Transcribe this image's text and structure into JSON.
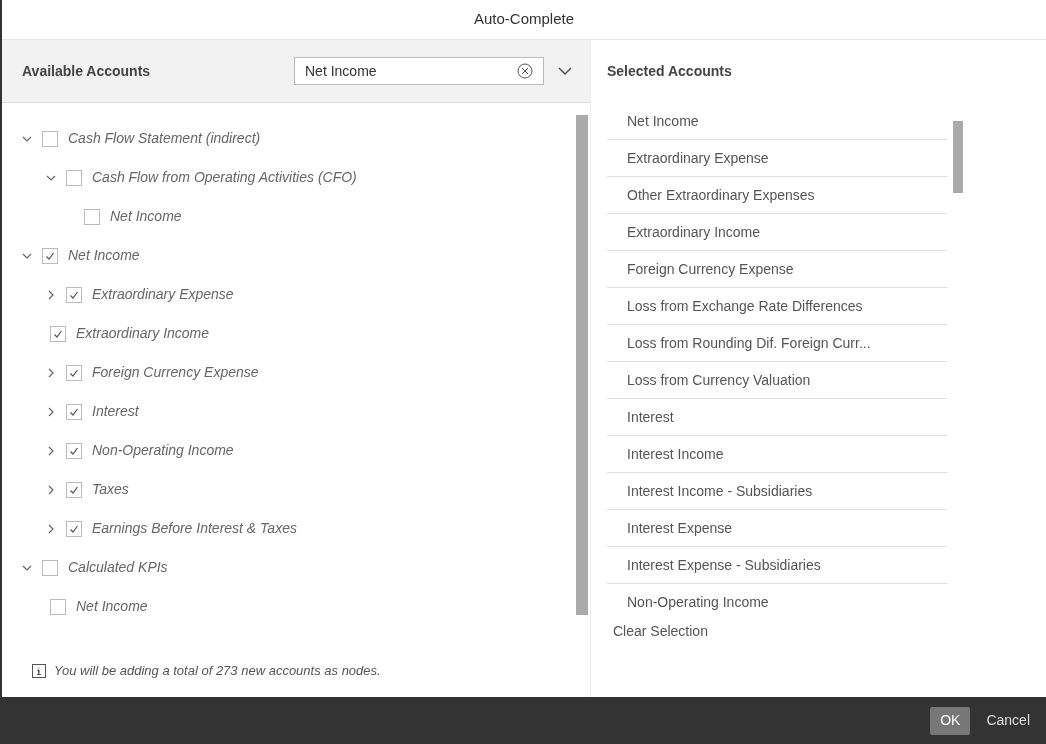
{
  "dialog": {
    "title": "Auto-Complete"
  },
  "available": {
    "title": "Available Accounts",
    "search": {
      "value": "Net Income"
    },
    "tree": [
      {
        "kind": "branch",
        "label": "Cash Flow Statement (indirect)",
        "checked": false,
        "expanded": true,
        "children": [
          {
            "kind": "branch",
            "label": "Cash Flow from Operating Activities (CFO)",
            "checked": false,
            "expanded": true,
            "children": [
              {
                "kind": "leaf",
                "label": "Net Income",
                "checked": false
              }
            ]
          }
        ]
      },
      {
        "kind": "branch",
        "label": "Net Income",
        "checked": true,
        "expanded": true,
        "children": [
          {
            "kind": "branch",
            "label": "Extraordinary Expense",
            "checked": true,
            "expanded": false
          },
          {
            "kind": "leaf",
            "label": "Extraordinary Income",
            "checked": true
          },
          {
            "kind": "branch",
            "label": "Foreign Currency Expense",
            "checked": true,
            "expanded": false
          },
          {
            "kind": "branch",
            "label": "Interest",
            "checked": true,
            "expanded": false
          },
          {
            "kind": "branch",
            "label": "Non-Operating Income",
            "checked": true,
            "expanded": false
          },
          {
            "kind": "branch",
            "label": "Taxes",
            "checked": true,
            "expanded": false
          },
          {
            "kind": "branch",
            "label": "Earnings Before Interest & Taxes",
            "checked": true,
            "expanded": false
          }
        ]
      },
      {
        "kind": "branch",
        "label": "Calculated KPIs",
        "checked": false,
        "expanded": true,
        "children": [
          {
            "kind": "leaf",
            "label": "Net Income",
            "checked": false
          }
        ]
      }
    ],
    "info": "You will be adding a total of 273 new accounts as nodes."
  },
  "selected": {
    "title": "Selected Accounts",
    "items": [
      "Net Income",
      "Extraordinary Expense",
      "Other Extraordinary Expenses",
      "Extraordinary Income",
      "Foreign Currency Expense",
      "Loss from Exchange Rate Differences",
      "Loss from Rounding Dif. Foreign Curr...",
      "Loss from Currency Valuation",
      "Interest",
      "Interest Income",
      "Interest Income - Subsidiaries",
      "Interest Expense",
      "Interest Expense - Subsidiaries",
      "Non-Operating Income"
    ],
    "clear": "Clear Selection"
  },
  "buttons": [
    {
      "kind": "primary",
      "label": "OK"
    },
    {
      "kind": "plain",
      "label": "Cancel"
    }
  ]
}
